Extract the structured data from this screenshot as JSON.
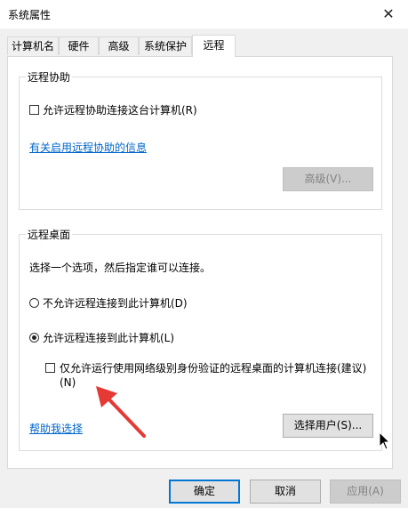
{
  "window": {
    "title": "系统属性",
    "close_glyph": "✕"
  },
  "tabs": [
    {
      "label": "计算机名"
    },
    {
      "label": "硬件"
    },
    {
      "label": "高级"
    },
    {
      "label": "系统保护"
    },
    {
      "label": "远程",
      "active": true
    }
  ],
  "remote_assistance": {
    "group_title": "远程协助",
    "allow_checkbox_label": "允许远程协助连接这台计算机(R)",
    "allow_checked": false,
    "info_link": "有关启用远程协助的信息",
    "advanced_button": "高级(V)..."
  },
  "remote_desktop": {
    "group_title": "远程桌面",
    "instruction": "选择一个选项，然后指定谁可以连接。",
    "option_deny": "不允许远程连接到此计算机(D)",
    "option_allow": "允许远程连接到此计算机(L)",
    "selected": "allow",
    "nla_checkbox_line1": "仅允许运行使用网络级别身份验证的远程桌面的计算机连接(建议)",
    "nla_checkbox_line2": "(N)",
    "nla_checked": false,
    "help_link": "帮助我选择",
    "select_users_button": "选择用户(S)..."
  },
  "footer": {
    "ok_button": "确定",
    "cancel_button": "取消",
    "apply_button": "应用(A)"
  },
  "colors": {
    "accent": "#0078d7",
    "link": "#0066cc",
    "annotation_arrow": "#e53935"
  }
}
